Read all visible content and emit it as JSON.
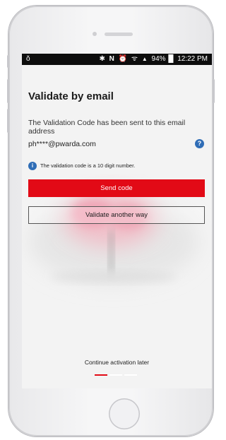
{
  "status_bar": {
    "left_icon": "ŏ",
    "bluetooth_icon": "✱",
    "nfc_icon": "N",
    "alarm_icon": "⏰",
    "wifi_icon": "ᯤ",
    "signal_icon": "▲",
    "battery_pct": "94%",
    "battery_icon": "█",
    "time": "12:22 PM"
  },
  "page": {
    "title": "Validate by email",
    "description": "The Validation Code has been sent to this email address",
    "email": "ph****@pwarda.com",
    "help_glyph": "?",
    "info_glyph": "i",
    "info_text": "The validation code is a 10 digit number."
  },
  "buttons": {
    "send_code": "Send code",
    "validate_another_way": "Validate another way"
  },
  "footer": {
    "continue_later": "Continue activation later",
    "pagination": {
      "total": 3,
      "active": 1
    }
  },
  "colors": {
    "accent_red": "#e20a16",
    "info_blue": "#2f6db6",
    "status_bar": "#0d0d0d"
  }
}
